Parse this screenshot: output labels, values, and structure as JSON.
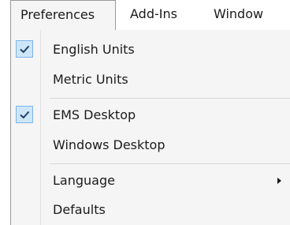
{
  "menubar": {
    "items": [
      {
        "label": "Preferences"
      },
      {
        "label": "Add-Ins"
      },
      {
        "label": "Window"
      }
    ]
  },
  "dropdown": {
    "items": [
      {
        "label": "English Units",
        "checked": true
      },
      {
        "label": "Metric Units",
        "checked": false
      },
      {
        "label": "EMS Desktop",
        "checked": true
      },
      {
        "label": "Windows Desktop",
        "checked": false
      },
      {
        "label": "Language",
        "has_submenu": true
      },
      {
        "label": "Defaults",
        "checked": false
      }
    ]
  },
  "colors": {
    "menu_background": "#f5f5f5",
    "check_background": "#cde6f7",
    "check_border": "#7eb4ea",
    "border": "#9a9a9a",
    "text": "#1b1b1b"
  },
  "icons": {
    "check": "check-icon",
    "submenu": "submenu-arrow-icon"
  }
}
